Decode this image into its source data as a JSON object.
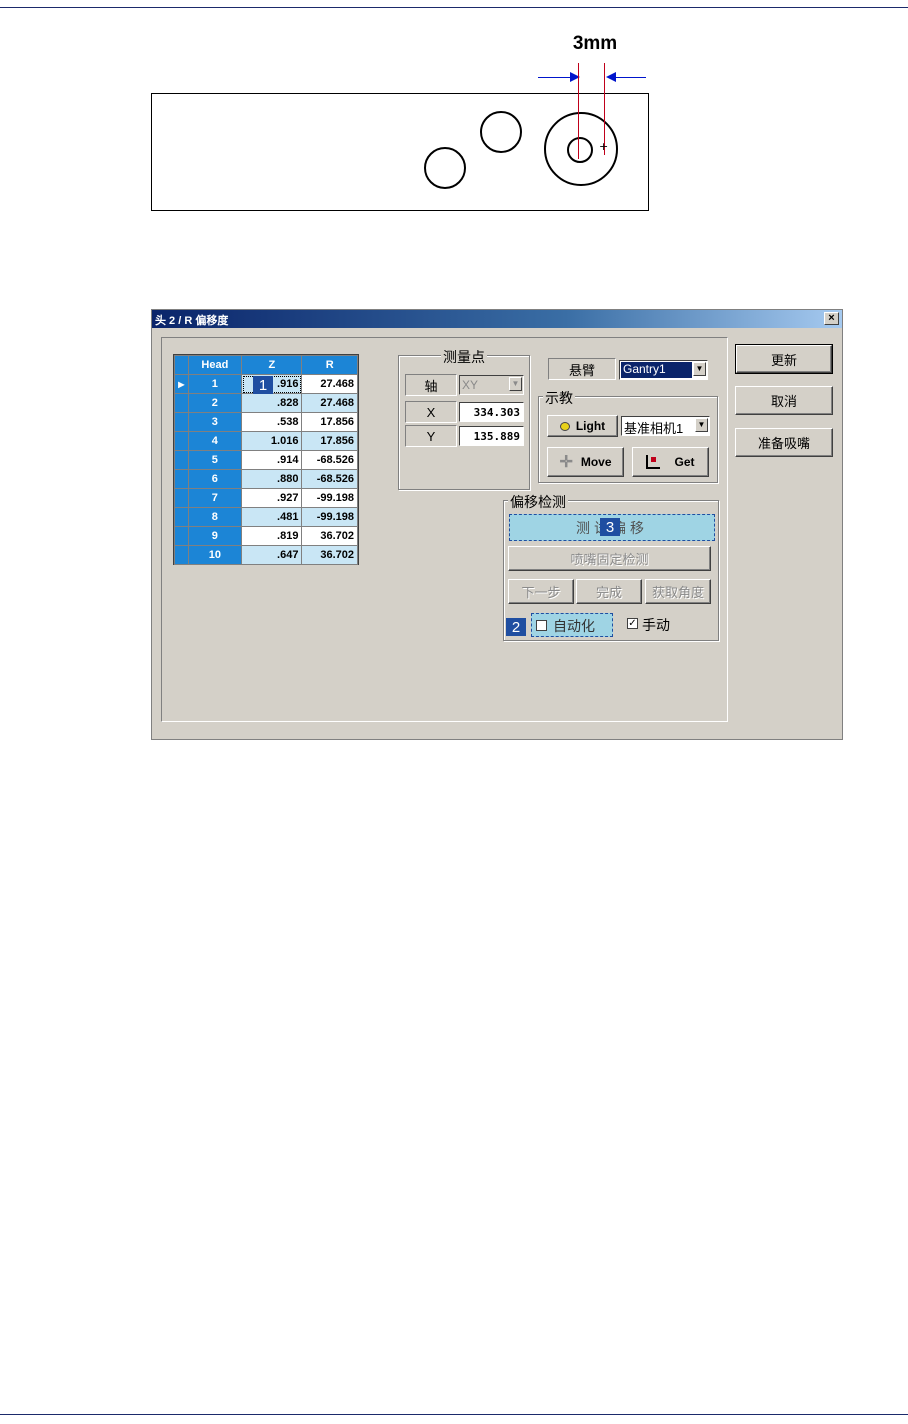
{
  "figure": {
    "dimension_label": "3mm"
  },
  "dialog": {
    "title": "头 2 / R 偏移度",
    "close_symbol": "×",
    "grid": {
      "columns": [
        "Head",
        "Z",
        "R"
      ],
      "rows": [
        {
          "head": "1",
          "z": ".916",
          "r": "27.468"
        },
        {
          "head": "2",
          "z": ".828",
          "r": "27.468"
        },
        {
          "head": "3",
          "z": ".538",
          "r": "17.856"
        },
        {
          "head": "4",
          "z": "1.016",
          "r": "17.856"
        },
        {
          "head": "5",
          "z": ".914",
          "r": "-68.526"
        },
        {
          "head": "6",
          "z": ".880",
          "r": "-68.526"
        },
        {
          "head": "7",
          "z": ".927",
          "r": "-99.198"
        },
        {
          "head": "8",
          "z": ".481",
          "r": "-99.198"
        },
        {
          "head": "9",
          "z": ".819",
          "r": "36.702"
        },
        {
          "head": "10",
          "z": ".647",
          "r": "36.702"
        }
      ]
    },
    "measure_point": {
      "title": "测量点",
      "axis_label": "轴",
      "axis_value": "XY",
      "x_label": "X",
      "x_value": "334.303",
      "y_label": "Y",
      "y_value": "135.889"
    },
    "gantry": {
      "label": "悬臂",
      "value": "Gantry1"
    },
    "teach": {
      "title": "示教",
      "light_label": "Light",
      "camera_value": "基准相机1",
      "move_label": "Move",
      "get_label": "Get"
    },
    "offset_detect": {
      "title": "偏移检测",
      "test_button": "测试偏移",
      "nozzle_check_button": "喷嘴固定检测",
      "next_button": "下一步",
      "done_button": "完成",
      "get_angle_button": "获取角度",
      "auto_label": "自动化",
      "auto_checked": false,
      "manual_label": "手动",
      "manual_checked": true,
      "manual_check_glyph": "✓"
    },
    "buttons": {
      "update": "更新",
      "cancel": "取消",
      "prepare_nozzle": "准备吸嘴"
    },
    "callouts": [
      "1",
      "2",
      "3"
    ]
  }
}
